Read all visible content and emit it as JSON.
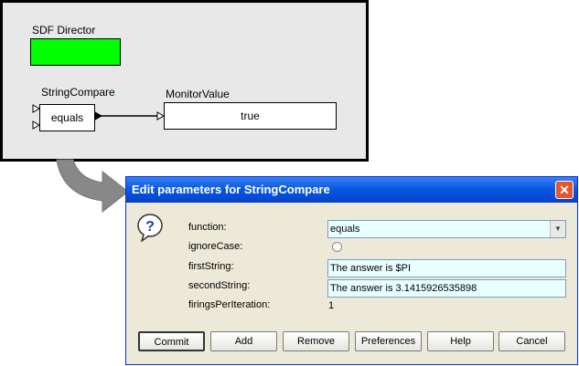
{
  "canvas": {
    "director_label": "SDF Director",
    "actor1_name": "StringCompare",
    "actor1_text": "equals",
    "actor2_name": "MonitorValue",
    "actor2_text": "true"
  },
  "dialog": {
    "title": "Edit parameters for StringCompare",
    "close_label": "✕",
    "params": {
      "function_label": "function:",
      "function_value": "equals",
      "ignorecase_label": "ignoreCase:",
      "firststring_label": "firstString:",
      "firststring_value": "The answer is $PI",
      "secondstring_label": "secondString:",
      "secondstring_value": "The answer is 3.1415926535898",
      "firings_label": "firingsPerIteration:",
      "firings_value": "1"
    },
    "buttons": {
      "commit": "Commit",
      "add": "Add",
      "remove": "Remove",
      "preferences": "Preferences",
      "help": "Help",
      "cancel": "Cancel"
    }
  },
  "icons": {
    "help": "question-icon",
    "arrow": "curved-arrow",
    "dropdown": "chevron-down-icon"
  },
  "colors": {
    "director": "#00ff00",
    "titlebar": "#0a5ae0",
    "field_bg": "#e8ffff",
    "dialog_bg": "#ece9d8"
  }
}
